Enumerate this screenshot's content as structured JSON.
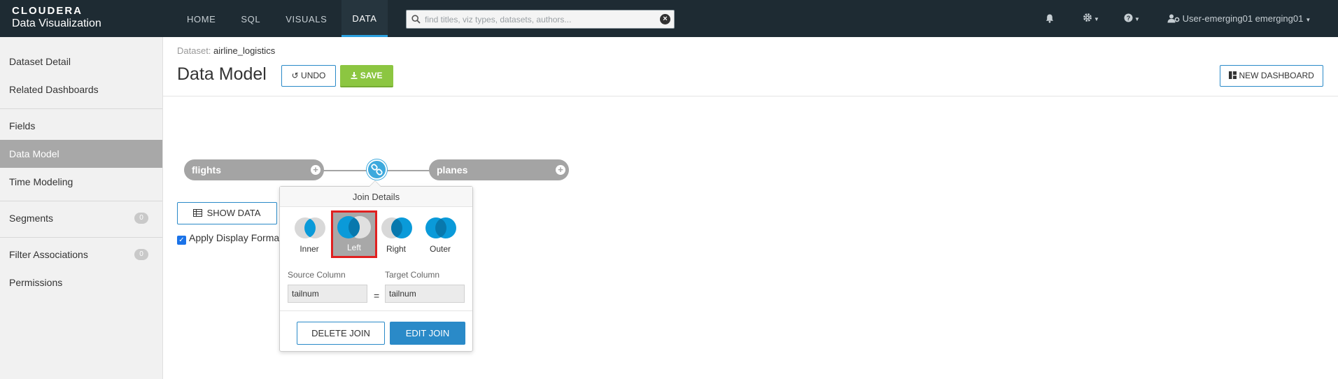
{
  "brand": {
    "name": "CLOUDERA",
    "product": "Data Visualization"
  },
  "nav": {
    "tabs": [
      {
        "label": "HOME"
      },
      {
        "label": "SQL"
      },
      {
        "label": "VISUALS"
      },
      {
        "label": "DATA",
        "active": true
      }
    ]
  },
  "search": {
    "placeholder": "find titles, viz types, datasets, authors..."
  },
  "top_icons": [
    "bell-icon",
    "gear-icon",
    "help-icon"
  ],
  "user": {
    "label": "User-emerging01 emerging01"
  },
  "sidebar": {
    "items": [
      {
        "label": "Dataset Detail"
      },
      {
        "label": "Related Dashboards"
      },
      {
        "label": "Fields"
      },
      {
        "label": "Data Model",
        "active": true
      },
      {
        "label": "Time Modeling"
      },
      {
        "label": "Segments",
        "count": "0"
      },
      {
        "label": "Filter Associations",
        "count": "0"
      },
      {
        "label": "Permissions"
      }
    ]
  },
  "header": {
    "dataset_prefix": "Dataset:",
    "dataset_name": "airline_logistics",
    "title": "Data Model",
    "undo_label": "UNDO",
    "save_label": "SAVE",
    "new_dashboard_label": "NEW DASHBOARD"
  },
  "model": {
    "left_table": "flights",
    "right_table": "planes",
    "show_data_label": "SHOW DATA",
    "apply_format_label": "Apply Display Format"
  },
  "join": {
    "title": "Join Details",
    "options": [
      {
        "label": "Inner"
      },
      {
        "label": "Left",
        "selected": true
      },
      {
        "label": "Right"
      },
      {
        "label": "Outer"
      }
    ],
    "source_label": "Source Column",
    "target_label": "Target Column",
    "source_value": "tailnum",
    "target_value": "tailnum",
    "equals": "=",
    "delete_label": "DELETE JOIN",
    "edit_label": "EDIT JOIN"
  },
  "colors": {
    "topbar": "#1e2b33",
    "accent_blue": "#2a8ac8",
    "join_blue": "#0a9ad9",
    "save_green": "#8cc641",
    "highlight_red": "#e02020"
  }
}
